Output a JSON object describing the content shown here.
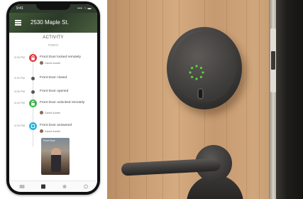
{
  "phone": {
    "status_time": "9:41",
    "status_signal": "▪▪▪ ◔ ▬",
    "address": "2530 Maple St.",
    "section_title": "ACTIVITY",
    "section_date": "TODAY",
    "events": [
      {
        "time": "3:25 PM",
        "text": "Front Door locked remotely",
        "user": "David Austin",
        "color": "#e0393e",
        "icon": "lock-icon"
      },
      {
        "time": "3:20 PM",
        "text": "Front Door closed",
        "user": "",
        "color": "#555555",
        "icon": "dot-icon"
      },
      {
        "time": "3:05 PM",
        "text": "Front Door opened",
        "user": "",
        "color": "#555555",
        "icon": "dot-icon"
      },
      {
        "time": "3:04 PM",
        "text": "Front Door unlocked remotely",
        "user": "David Austin",
        "color": "#39b54a",
        "icon": "unlock-icon"
      },
      {
        "time": "3:03 PM",
        "text": "Front Door answered",
        "user": "David Austin",
        "color": "#2bb3d9",
        "icon": "doorbell-icon"
      }
    ],
    "snapshot_label": "Front Door",
    "tabs": [
      "activity-tab",
      "home-tab",
      "keychain-tab",
      "settings-tab"
    ]
  },
  "photo": {
    "subject": "smart-lock",
    "led_color": "#5fd13a"
  }
}
